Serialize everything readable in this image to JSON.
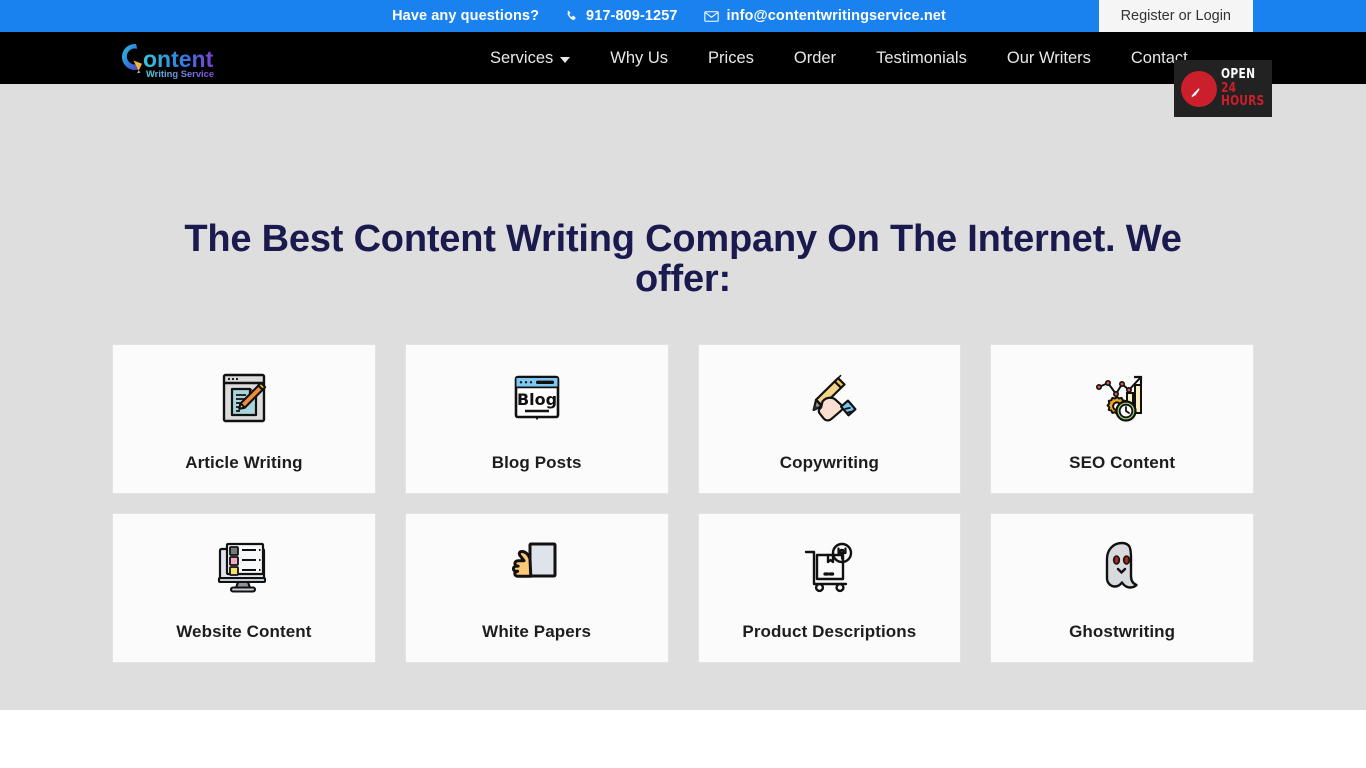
{
  "topbar": {
    "question": "Have any questions?",
    "phone": "917-809-1257",
    "email": "info@contentwritingservice.net",
    "register_label": "Register or Login",
    "background_color": "#1a82ef"
  },
  "navbar": {
    "background_color": "#000000",
    "logo": {
      "name": "Content",
      "tagline": "Writing Service"
    },
    "links": [
      {
        "label": "Services",
        "has_dropdown": true
      },
      {
        "label": "Why Us",
        "has_dropdown": false
      },
      {
        "label": "Prices",
        "has_dropdown": false
      },
      {
        "label": "Order",
        "has_dropdown": false
      },
      {
        "label": "Testimonials",
        "has_dropdown": false
      },
      {
        "label": "Our Writers",
        "has_dropdown": false
      },
      {
        "label": "Contact",
        "has_dropdown": false
      }
    ],
    "open_badge": {
      "line1": "OPEN",
      "line2": "24 HOURS",
      "accent_color": "#cc1f2c"
    }
  },
  "hero": {
    "background_color": "#dedede",
    "title": "The Best Content Writing Company On The Internet. We offer:",
    "title_color": "#1a1a4e",
    "cards": [
      {
        "label": "Article Writing",
        "icon": "article-writing-icon"
      },
      {
        "label": "Blog Posts",
        "icon": "blog-posts-icon"
      },
      {
        "label": "Copywriting",
        "icon": "copywriting-icon"
      },
      {
        "label": "SEO Content",
        "icon": "seo-content-icon"
      },
      {
        "label": "Website Content",
        "icon": "website-content-icon"
      },
      {
        "label": "White Papers",
        "icon": "white-papers-icon"
      },
      {
        "label": "Product Descriptions",
        "icon": "product-descriptions-icon"
      },
      {
        "label": "Ghostwriting",
        "icon": "ghostwriting-icon"
      }
    ]
  }
}
